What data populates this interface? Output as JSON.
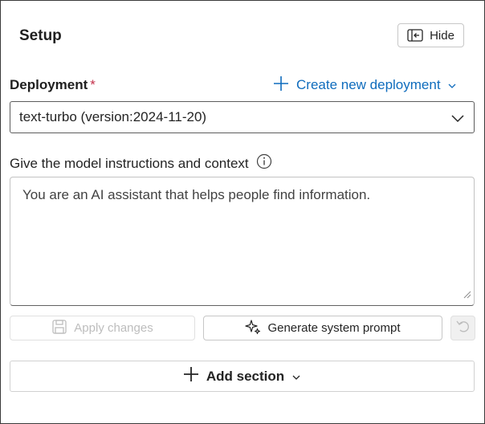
{
  "panel": {
    "title": "Setup",
    "hide_label": "Hide"
  },
  "deployment": {
    "label": "Deployment",
    "required_mark": "*",
    "create_link": "Create new deployment",
    "selected_value": "text-turbo (version:2024-11-20)"
  },
  "instructions": {
    "label": "Give the model instructions and context",
    "value": "You are an AI assistant that helps people find information."
  },
  "actions": {
    "apply_label": "Apply changes",
    "generate_label": "Generate system prompt"
  },
  "add_section": {
    "label": "Add section"
  },
  "colors": {
    "link": "#0f6cbd",
    "required": "#c4314b",
    "disabled_text": "#bdbdbd"
  },
  "icons": [
    "panel-collapse-icon",
    "plus-icon",
    "chevron-down-icon",
    "info-icon",
    "save-icon",
    "sparkle-icon",
    "undo-icon",
    "resize-grip-icon"
  ]
}
